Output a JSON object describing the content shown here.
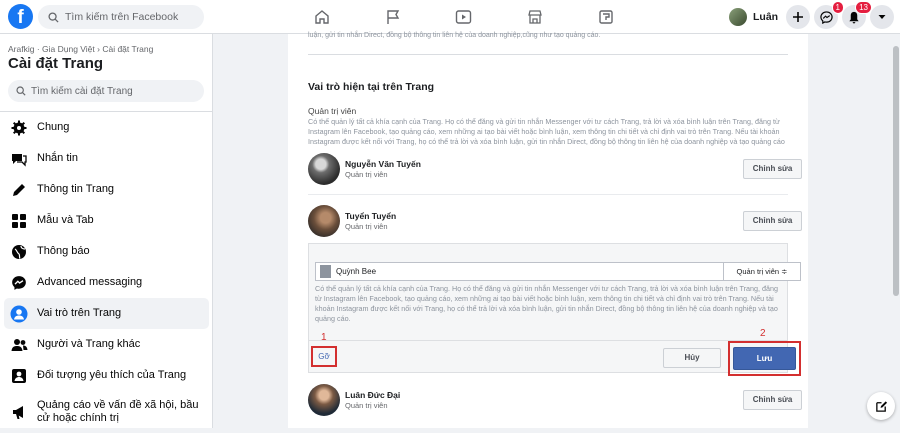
{
  "topbar": {
    "logo_letter": "f",
    "search_placeholder": "Tìm kiếm trên Facebook",
    "nav_icons": [
      "home-icon",
      "flag-icon",
      "watch-icon",
      "marketplace-icon",
      "gaming-icon"
    ],
    "profile_name": "Luân",
    "messenger_badge": "1",
    "notifications_badge": "13"
  },
  "sidebar": {
    "breadcrumb": "Arafkig · Gia Dụng Việt › Cài đặt Trang",
    "title": "Cài đặt Trang",
    "search_placeholder": "Tìm kiếm cài đặt Trang",
    "items": [
      {
        "label": "Chung",
        "icon": "gear-icon"
      },
      {
        "label": "Nhắn tin",
        "icon": "chat-icon"
      },
      {
        "label": "Thông tin Trang",
        "icon": "pencil-icon"
      },
      {
        "label": "Mẫu và Tab",
        "icon": "grid-icon"
      },
      {
        "label": "Thông báo",
        "icon": "globe-icon"
      },
      {
        "label": "Advanced messaging",
        "icon": "messenger-icon"
      },
      {
        "label": "Vai trò trên Trang",
        "icon": "person-icon",
        "active": true
      },
      {
        "label": "Người và Trang khác",
        "icon": "people-icon"
      },
      {
        "label": "Đối tượng yêu thích của Trang",
        "icon": "audience-icon"
      },
      {
        "label": "Quảng cáo về vấn đề xã hội, bầu cử hoặc chính trị",
        "icon": "megaphone-icon"
      }
    ]
  },
  "main": {
    "top_hint": "luận, gửi tin nhắn Direct, đồng bộ thông tin liên hệ của doanh nghiệp,cũng như tạo quảng cáo.",
    "section_title": "Vai trò hiện tại trên Trang",
    "role_heading": "Quản trị viên",
    "role_description": "Có thể quản lý tất cả khía cạnh của Trang. Họ có thể đăng và gửi tin nhắn Messenger với tư cách Trang, trả lời và xóa bình luận trên Trang, đăng từ Instagram lên Facebook, tạo quảng cáo, xem những ai tạo bài viết hoặc bình luận, xem thông tin chi tiết và chỉ định vai trò trên Trang. Nếu tài khoản Instagram được kết nối với Trang, họ có thể trả lời và xóa bình luận, gửi tin nhắn Direct, đồng bộ thông tin liên hệ của doanh nghiệp và tạo quảng cáo",
    "edit_label": "Chỉnh sửa",
    "people": [
      {
        "name": "Nguyễn Văn Tuyến",
        "role": "Quản trị viên"
      },
      {
        "name": "Tuyển Tuyển",
        "role": "Quản trị viên"
      },
      {
        "name": "Luân Đức Đại",
        "role": "Quản trị viên"
      }
    ],
    "edit_box": {
      "user_value": "Quỳnh Bee",
      "role_select": "Quản trị viên ≑",
      "description": "Có thể quản lý tất cả khía cạnh của Trang. Họ có thể đăng và gửi tin nhắn Messenger với tư cách Trang, trả lời và xóa bình luận trên Trang, đăng từ Instagram lên Facebook, tạo quảng cáo, xem những ai tạo bài viết hoặc bình luận, xem thông tin chi tiết và chỉ định vai trò trên Trang. Nếu tài khoản Instagram được kết nối với Trang, họ có thể trả lời và xóa bình luận, gửi tin nhắn Direct, đồng bộ thông tin liên hệ của doanh nghiệp và tạo quảng cáo.",
      "remove_label": "Gỡ",
      "cancel_label": "Hủy",
      "save_label": "Lưu",
      "marker_1": "1",
      "marker_2": "2"
    }
  },
  "colors": {
    "brand": "#1877f2",
    "save": "#4267b2",
    "annotation": "#d32f2f"
  }
}
